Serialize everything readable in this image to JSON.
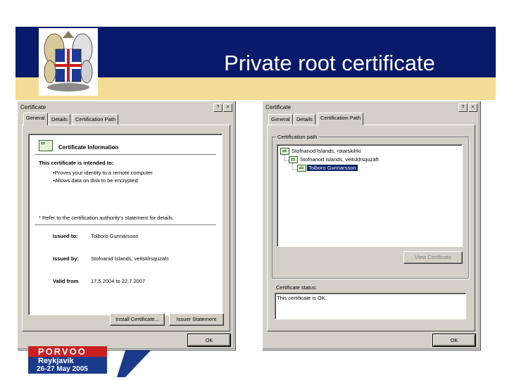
{
  "slide": {
    "title": "Private root certificate",
    "logo": {
      "top_text": "PORVOO",
      "middle_text": "Reykjavik",
      "date_text": "26-27 May 2005"
    }
  },
  "left_dialog": {
    "title": "Certificate",
    "help_btn": "?",
    "close_btn": "×",
    "tabs": [
      "General",
      "Details",
      "Certification Path"
    ],
    "active_tab": "General",
    "info_heading": "Certificate Information",
    "intended_heading": "This certificate is intended to:",
    "purposes": [
      "•Proves your identity to a remote computer",
      "•Allows data on disk to be encrypted"
    ],
    "refer_note": "* Refer to the certification authority's statement for details.",
    "issued_to_label": "Issued to:",
    "issued_to_value": "Tolboro Gunnarsson",
    "issued_by_label": "Issued by:",
    "issued_by_value": "Stofnanid Islands, veitsklrsquzafs",
    "valid_from_label": "Valid from",
    "valid_from_value": "17.5.2004 to 22.7.2007",
    "install_btn": "Install Certificate...",
    "issuer_btn": "Issuer Statement",
    "ok_btn": "OK"
  },
  "right_dialog": {
    "title": "Certificate",
    "help_btn": "?",
    "close_btn": "×",
    "tabs": [
      "General",
      "Details",
      "Certification Path"
    ],
    "active_tab": "Certification Path",
    "path_group_label": "Certification path",
    "path_items": [
      "Stofnanod Islands, rotarskilrki",
      "Stofnanod Islands, veitsklrsquzaft",
      "Tolboro Gunnarsson"
    ],
    "view_cert_btn": "View Certificate",
    "status_label": "Certificate status:",
    "status_text": "This certificate is OK.",
    "ok_btn": "OK"
  }
}
